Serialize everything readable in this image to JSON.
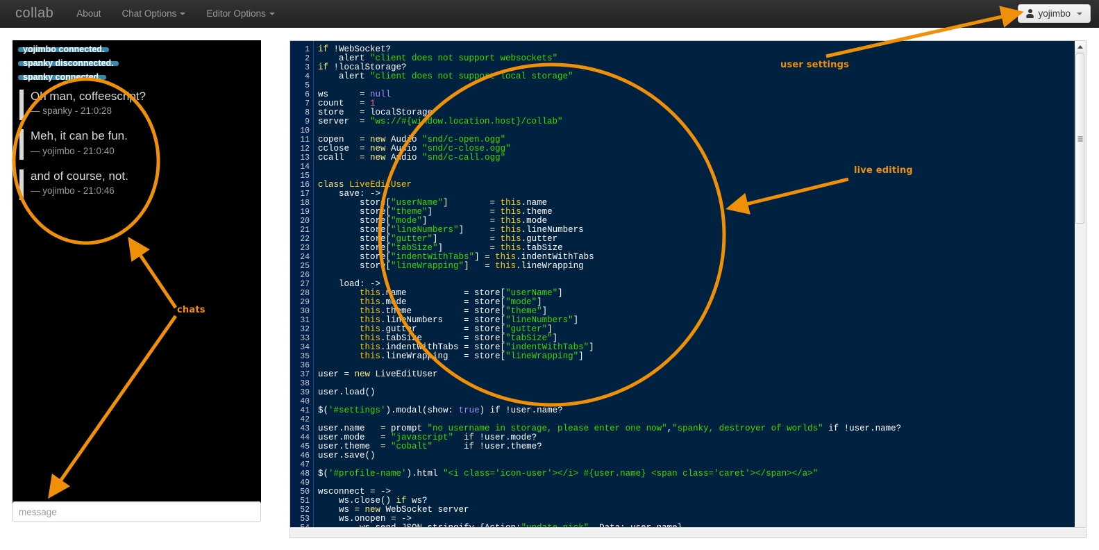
{
  "navbar": {
    "brand": "collab",
    "items": [
      {
        "label": "About",
        "has_caret": false
      },
      {
        "label": "Chat Options",
        "has_caret": true
      },
      {
        "label": "Editor Options",
        "has_caret": true
      }
    ],
    "user_button": {
      "label": "yojimbo",
      "icon": "user-icon",
      "caret": true
    }
  },
  "chat": {
    "system_messages": [
      "yojimbo connected.",
      "spanky disconnected.",
      "spanky connected."
    ],
    "messages": [
      {
        "text": "Oh man, coffeescript?",
        "meta": "— spanky - 21:0:28"
      },
      {
        "text": "Meh, it can be fun.",
        "meta": "— yojimbo - 21:0:40"
      },
      {
        "text": "and of course, not.",
        "meta": "— yojimbo - 21:0:46"
      }
    ],
    "input": {
      "value": "",
      "placeholder": "message"
    }
  },
  "editor": {
    "language": "coffeescript",
    "theme": "cobalt",
    "first_line": 1,
    "last_visible_line": 54,
    "lines": [
      {
        "n": 1,
        "tokens": [
          [
            "kw",
            "if "
          ],
          [
            "def",
            "!WebSocket?"
          ]
        ]
      },
      {
        "n": 2,
        "tokens": [
          [
            "def",
            "    alert "
          ],
          [
            "str",
            "\"client does not support websockets\""
          ]
        ]
      },
      {
        "n": 3,
        "tokens": [
          [
            "kw",
            "if "
          ],
          [
            "def",
            "!localStorage?"
          ]
        ]
      },
      {
        "n": 4,
        "tokens": [
          [
            "def",
            "    alert "
          ],
          [
            "str",
            "\"client does not support local storage\""
          ]
        ]
      },
      {
        "n": 5,
        "tokens": []
      },
      {
        "n": 6,
        "tokens": [
          [
            "def",
            "ws      = "
          ],
          [
            "atom",
            "null"
          ]
        ]
      },
      {
        "n": 7,
        "tokens": [
          [
            "def",
            "count   = "
          ],
          [
            "num",
            "1"
          ]
        ]
      },
      {
        "n": 8,
        "tokens": [
          [
            "def",
            "store   = localStorage"
          ]
        ]
      },
      {
        "n": 9,
        "tokens": [
          [
            "def",
            "server  = "
          ],
          [
            "str",
            "\"ws://#{window.location.host}/collab\""
          ]
        ]
      },
      {
        "n": 10,
        "tokens": []
      },
      {
        "n": 11,
        "tokens": [
          [
            "def",
            "copen   = "
          ],
          [
            "kw",
            "new"
          ],
          [
            "def",
            " Audio "
          ],
          [
            "str",
            "\"snd/c-open.ogg\""
          ]
        ]
      },
      {
        "n": 12,
        "tokens": [
          [
            "def",
            "cclose  = "
          ],
          [
            "kw",
            "new"
          ],
          [
            "def",
            " Audio "
          ],
          [
            "str",
            "\"snd/c-close.ogg\""
          ]
        ]
      },
      {
        "n": 13,
        "tokens": [
          [
            "def",
            "ccall   = "
          ],
          [
            "kw",
            "new"
          ],
          [
            "def",
            " Audio "
          ],
          [
            "str",
            "\"snd/c-call.ogg\""
          ]
        ]
      },
      {
        "n": 14,
        "tokens": []
      },
      {
        "n": 15,
        "tokens": []
      },
      {
        "n": 16,
        "tokens": [
          [
            "kw",
            "class "
          ],
          [
            "var",
            "LiveEditUser"
          ]
        ]
      },
      {
        "n": 17,
        "tokens": [
          [
            "def",
            "    save: ->"
          ]
        ]
      },
      {
        "n": 18,
        "tokens": [
          [
            "def",
            "        store["
          ],
          [
            "str",
            "\"userName\""
          ],
          [
            "def",
            "]        = "
          ],
          [
            "var",
            "this"
          ],
          [
            "def",
            ".name"
          ]
        ]
      },
      {
        "n": 19,
        "tokens": [
          [
            "def",
            "        store["
          ],
          [
            "str",
            "\"theme\""
          ],
          [
            "def",
            "]           = "
          ],
          [
            "var",
            "this"
          ],
          [
            "def",
            ".theme"
          ]
        ]
      },
      {
        "n": 20,
        "tokens": [
          [
            "def",
            "        store["
          ],
          [
            "str",
            "\"mode\""
          ],
          [
            "def",
            "]            = "
          ],
          [
            "var",
            "this"
          ],
          [
            "def",
            ".mode"
          ]
        ]
      },
      {
        "n": 21,
        "tokens": [
          [
            "def",
            "        store["
          ],
          [
            "str",
            "\"lineNumbers\""
          ],
          [
            "def",
            "]     = "
          ],
          [
            "var",
            "this"
          ],
          [
            "def",
            ".lineNumbers"
          ]
        ]
      },
      {
        "n": 22,
        "tokens": [
          [
            "def",
            "        store["
          ],
          [
            "str",
            "\"gutter\""
          ],
          [
            "def",
            "]          = "
          ],
          [
            "var",
            "this"
          ],
          [
            "def",
            ".gutter"
          ]
        ]
      },
      {
        "n": 23,
        "tokens": [
          [
            "def",
            "        store["
          ],
          [
            "str",
            "\"tabSize\""
          ],
          [
            "def",
            "]         = "
          ],
          [
            "var",
            "this"
          ],
          [
            "def",
            ".tabSize"
          ]
        ]
      },
      {
        "n": 24,
        "tokens": [
          [
            "def",
            "        store["
          ],
          [
            "str",
            "\"indentWithTabs\""
          ],
          [
            "def",
            "] = "
          ],
          [
            "var",
            "this"
          ],
          [
            "def",
            ".indentWithTabs"
          ]
        ]
      },
      {
        "n": 25,
        "tokens": [
          [
            "def",
            "        store["
          ],
          [
            "str",
            "\"lineWrapping\""
          ],
          [
            "def",
            "]   = "
          ],
          [
            "var",
            "this"
          ],
          [
            "def",
            ".lineWrapping"
          ]
        ]
      },
      {
        "n": 26,
        "tokens": []
      },
      {
        "n": 27,
        "tokens": [
          [
            "def",
            "    load: ->"
          ]
        ]
      },
      {
        "n": 28,
        "tokens": [
          [
            "def",
            "        "
          ],
          [
            "var",
            "this"
          ],
          [
            "def",
            ".name           = store["
          ],
          [
            "str",
            "\"userName\""
          ],
          [
            "def",
            "]"
          ]
        ]
      },
      {
        "n": 29,
        "tokens": [
          [
            "def",
            "        "
          ],
          [
            "var",
            "this"
          ],
          [
            "def",
            ".mode           = store["
          ],
          [
            "str",
            "\"mode\""
          ],
          [
            "def",
            "]"
          ]
        ]
      },
      {
        "n": 30,
        "tokens": [
          [
            "def",
            "        "
          ],
          [
            "var",
            "this"
          ],
          [
            "def",
            ".theme          = store["
          ],
          [
            "str",
            "\"theme\""
          ],
          [
            "def",
            "]"
          ]
        ]
      },
      {
        "n": 31,
        "tokens": [
          [
            "def",
            "        "
          ],
          [
            "var",
            "this"
          ],
          [
            "def",
            ".lineNumbers    = store["
          ],
          [
            "str",
            "\"lineNumbers\""
          ],
          [
            "def",
            "]"
          ]
        ]
      },
      {
        "n": 32,
        "tokens": [
          [
            "def",
            "        "
          ],
          [
            "var",
            "this"
          ],
          [
            "def",
            ".gutter         = store["
          ],
          [
            "str",
            "\"gutter\""
          ],
          [
            "def",
            "]"
          ]
        ]
      },
      {
        "n": 33,
        "tokens": [
          [
            "def",
            "        "
          ],
          [
            "var",
            "this"
          ],
          [
            "def",
            ".tabSize        = store["
          ],
          [
            "str",
            "\"tabSize\""
          ],
          [
            "def",
            "]"
          ]
        ]
      },
      {
        "n": 34,
        "tokens": [
          [
            "def",
            "        "
          ],
          [
            "var",
            "this"
          ],
          [
            "def",
            ".indentWithTabs = store["
          ],
          [
            "str",
            "\"indentWithTabs\""
          ],
          [
            "def",
            "]"
          ]
        ]
      },
      {
        "n": 35,
        "tokens": [
          [
            "def",
            "        "
          ],
          [
            "var",
            "this"
          ],
          [
            "def",
            ".lineWrapping   = store["
          ],
          [
            "str",
            "\"lineWrapping\""
          ],
          [
            "def",
            "]"
          ]
        ]
      },
      {
        "n": 36,
        "tokens": []
      },
      {
        "n": 37,
        "tokens": [
          [
            "def",
            "user = "
          ],
          [
            "kw",
            "new"
          ],
          [
            "def",
            " LiveEditUser"
          ]
        ]
      },
      {
        "n": 38,
        "tokens": []
      },
      {
        "n": 39,
        "tokens": [
          [
            "def",
            "user.load()"
          ]
        ]
      },
      {
        "n": 40,
        "tokens": []
      },
      {
        "n": 41,
        "tokens": [
          [
            "def",
            "$("
          ],
          [
            "str",
            "'#settings'"
          ],
          [
            "def",
            ").modal(show: "
          ],
          [
            "atom",
            "true"
          ],
          [
            "def",
            ") if !user.name?"
          ]
        ]
      },
      {
        "n": 42,
        "tokens": []
      },
      {
        "n": 43,
        "tokens": [
          [
            "def",
            "user.name   = prompt "
          ],
          [
            "str",
            "\"no username in storage, please enter one now\""
          ],
          [
            "def",
            ","
          ],
          [
            "str",
            "\"spanky, destroyer of worlds\""
          ],
          [
            "def",
            " if !user.name?"
          ]
        ]
      },
      {
        "n": 44,
        "tokens": [
          [
            "def",
            "user.mode   = "
          ],
          [
            "str",
            "\"javascript\""
          ],
          [
            "def",
            "  if !user.mode?"
          ]
        ]
      },
      {
        "n": 45,
        "tokens": [
          [
            "def",
            "user.theme  = "
          ],
          [
            "str",
            "\"cobalt\""
          ],
          [
            "def",
            "      if !user.theme?"
          ]
        ]
      },
      {
        "n": 46,
        "tokens": [
          [
            "def",
            "user.save()"
          ]
        ]
      },
      {
        "n": 47,
        "tokens": []
      },
      {
        "n": 48,
        "tokens": [
          [
            "def",
            "$("
          ],
          [
            "str",
            "'#profile-name'"
          ],
          [
            "def",
            ").html "
          ],
          [
            "str",
            "\"<i class='icon-user'></i> #{user.name} <span class='caret'></span></a>\""
          ]
        ]
      },
      {
        "n": 49,
        "tokens": []
      },
      {
        "n": 50,
        "tokens": [
          [
            "def",
            "wsconnect = ->"
          ]
        ]
      },
      {
        "n": 51,
        "tokens": [
          [
            "def",
            "    ws.close() "
          ],
          [
            "kw",
            "if"
          ],
          [
            "def",
            " ws?"
          ]
        ]
      },
      {
        "n": 52,
        "tokens": [
          [
            "def",
            "    ws = "
          ],
          [
            "kw",
            "new"
          ],
          [
            "def",
            " WebSocket server"
          ]
        ]
      },
      {
        "n": 53,
        "tokens": [
          [
            "def",
            "    ws.onopen = ->"
          ]
        ]
      },
      {
        "n": 54,
        "tokens": [
          [
            "def",
            "        ws.send JSON.stringify {Action:"
          ],
          [
            "str",
            "\"update-nick\""
          ],
          [
            "def",
            ", Data: user.name}"
          ]
        ]
      }
    ]
  },
  "annotations": [
    {
      "id": "user-settings",
      "label": "user settings"
    },
    {
      "id": "live-editing",
      "label": "live editing"
    },
    {
      "id": "chats",
      "label": "chats"
    }
  ],
  "colors": {
    "annotation": "#ef9008",
    "editor_bg": "#002240",
    "gutter_bg": "#00204a",
    "navbar_bg": "#222222",
    "chat_bg": "#000000",
    "system_badge": "#3a87ad",
    "string": "#3ad900",
    "keyword": "#ffee80",
    "variable": "#ffc600",
    "number": "#ff628c",
    "atom": "#a78bfa"
  },
  "scrollbar": {
    "vertical_position_pct": 2,
    "horizontal_position_pct": 0
  }
}
